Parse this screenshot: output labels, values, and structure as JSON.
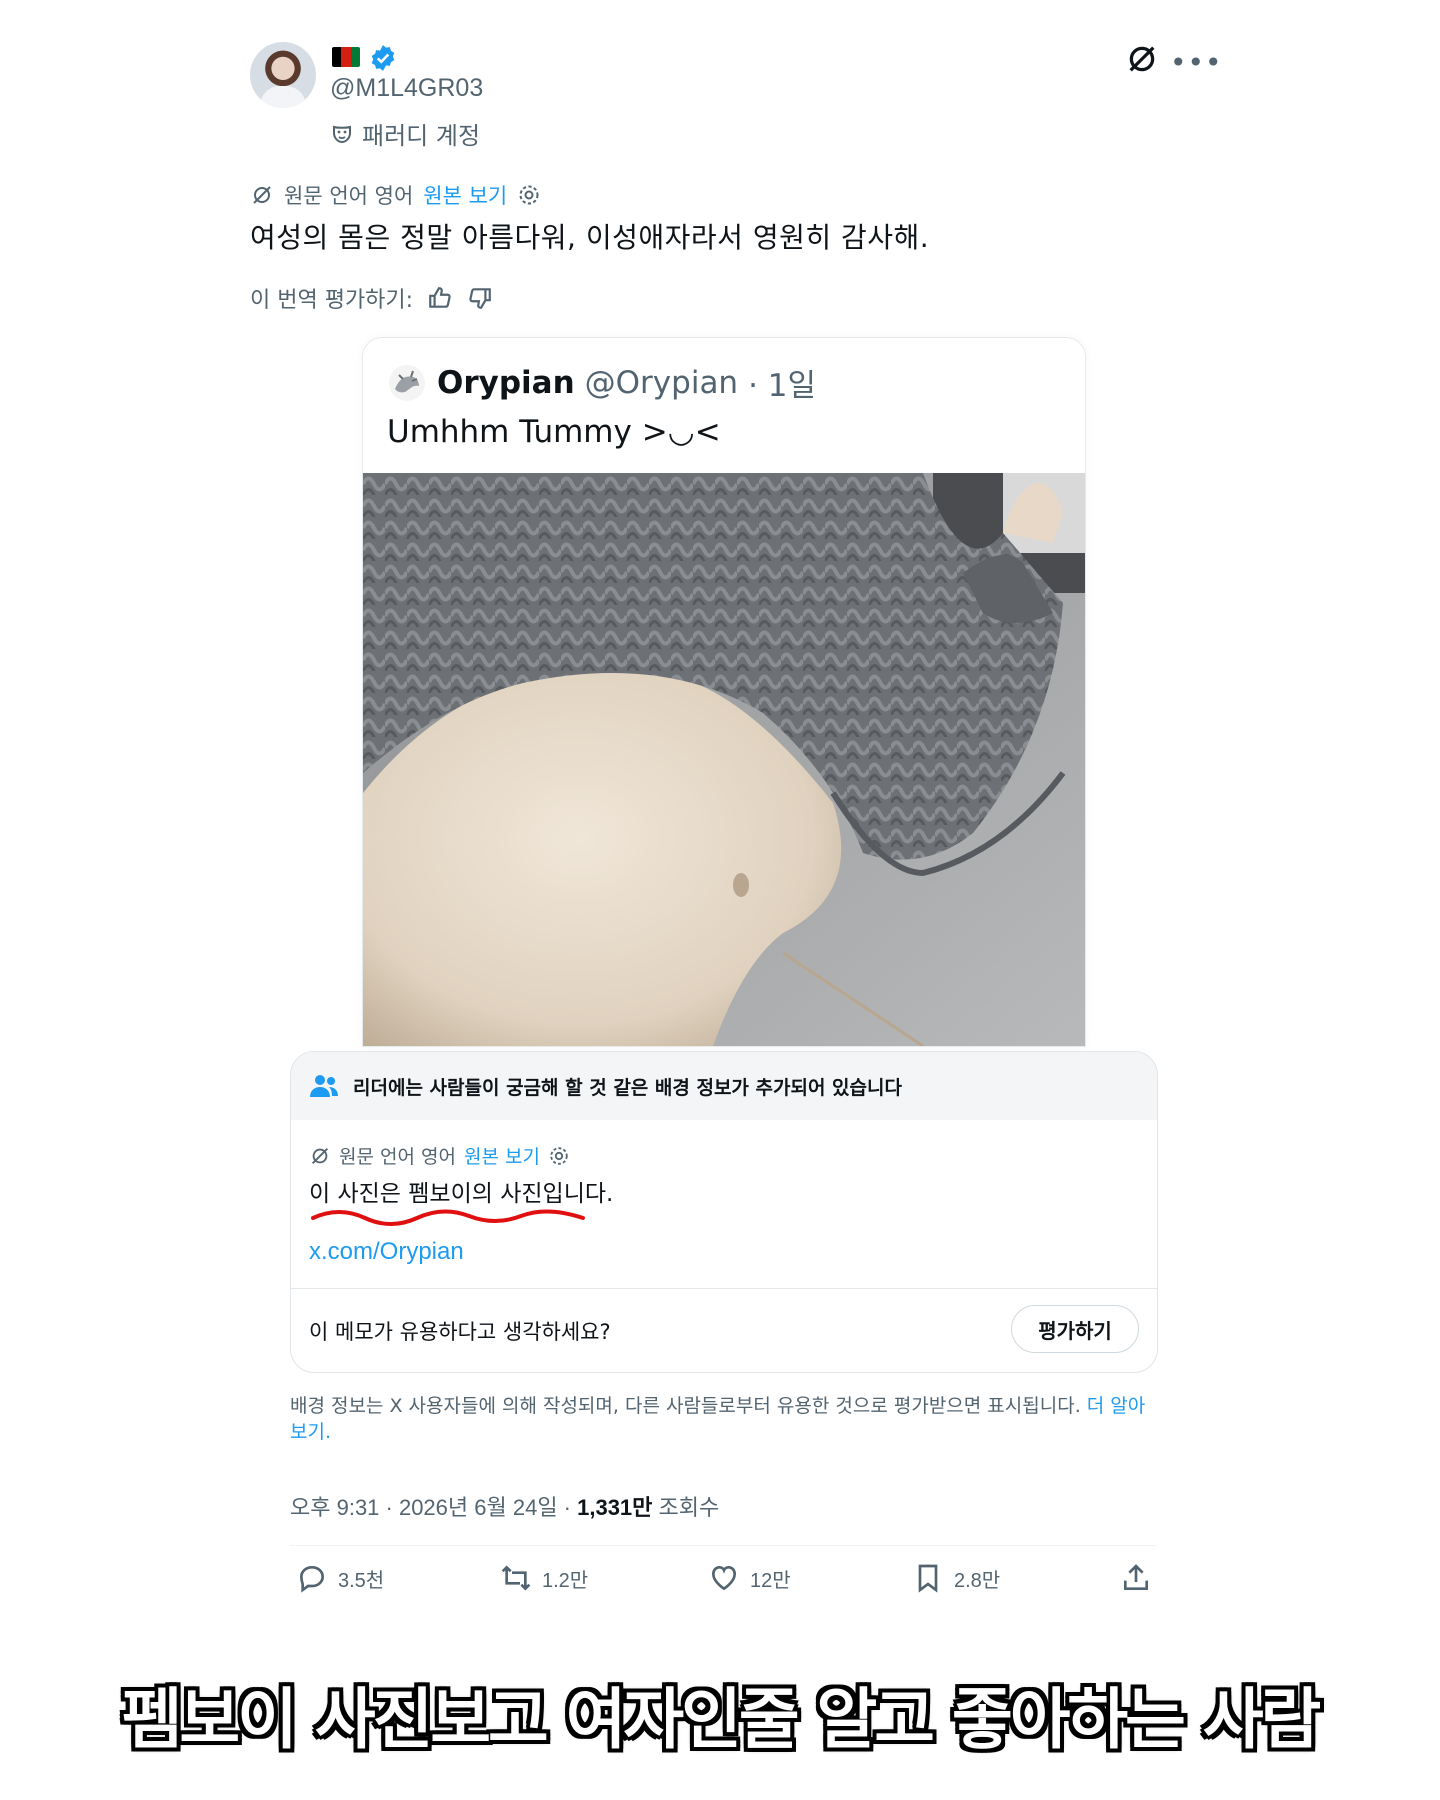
{
  "post": {
    "handle": "@M1L4GR03",
    "parody_label": "패러디 계정",
    "translation": {
      "source_label": "원문 언어 영어",
      "view_original": "원본 보기"
    },
    "text": "여성의 몸은 정말 아름다워, 이성애자라서 영원히 감사해.",
    "rate_translation": "이 번역 평가하기:"
  },
  "quoted": {
    "name": "Orypian",
    "handle": "@Orypian",
    "time": "· 1일",
    "text": "Umhhm Tummy >◡<"
  },
  "community_note": {
    "header": "리더에는 사람들이 궁금해 할 것 같은 배경 정보가 추가되어 있습니다",
    "translation_label": "원문 언어 영어",
    "view_original": "원본 보기",
    "text": "이 사진은 펨보이의 사진입니다.",
    "link": "x.com/Orypian",
    "question": "이 메모가 유용하다고 생각하세요?",
    "rate_button": "평가하기"
  },
  "footnote": {
    "text": "배경 정보는 X 사용자들에 의해 작성되며, 다른 사람들로부터 유용한 것으로 평가받으면 표시됩니다.",
    "learn_more": "더 알아보기."
  },
  "meta": {
    "time": "오후 9:31 · 2026년 6월 24일 · ",
    "views": "1,331만",
    "views_label": " 조회수"
  },
  "actions": {
    "replies": "3.5천",
    "reposts": "1.2만",
    "likes": "12만",
    "bookmarks": "2.8만"
  },
  "caption": "펨보이 사진보고 여자인줄 알고 좋아하는 사람",
  "colors": {
    "accent": "#1d9bf0",
    "muted": "#536471",
    "underline": "#e01010"
  },
  "icons": [
    "verified-badge-icon",
    "afghanistan-flag-icon",
    "grok-icon",
    "more-icon",
    "mask-icon",
    "translate-icon",
    "gear-icon",
    "thumbs-up-icon",
    "thumbs-down-icon",
    "people-icon",
    "reply-icon",
    "repost-icon",
    "like-icon",
    "bookmark-icon",
    "share-icon"
  ]
}
